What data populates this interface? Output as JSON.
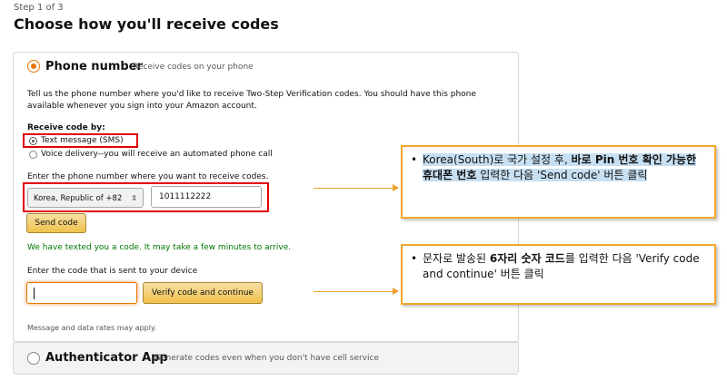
{
  "header": {
    "step": "Step 1 of 3",
    "title": "Choose how you'll receive codes"
  },
  "phone_option": {
    "title": "Phone number",
    "description": "Receive codes on your phone",
    "selected": true,
    "intro_line1": "Tell us the phone number where you'd like to receive Two-Step Verification codes. You should have this phone",
    "intro_line2": "available whenever you sign into your Amazon account.",
    "receive_label": "Receive code by:",
    "methods": [
      {
        "label": "Text message (SMS)",
        "selected": true
      },
      {
        "label": "Voice delivery--you will receive an automated phone call",
        "selected": false
      }
    ],
    "phone_label": "Enter the phone number where you want to receive codes.",
    "country_select": "Korea, Republic of +82",
    "phone_value": "1011112222",
    "send_button": "Send code",
    "sent_message": "We have texted you a code. It may take a few minutes to arrive.",
    "code_label": "Enter the code that is sent to your device",
    "code_value": "",
    "verify_button": "Verify code and continue",
    "footnote": "Message and data rates may apply."
  },
  "auth_option": {
    "title": "Authenticator App",
    "description": "Generate codes even when you don't have cell service",
    "selected": false
  },
  "callouts": {
    "first": {
      "part1": "Korea(South)로 국가 설정 후, ",
      "bold1": "바로 Pin 번호 확인 가능한 휴대폰 번호",
      "part2": " 입력한 다음 'Send code' 버튼 클릭"
    },
    "second": {
      "part1": "문자로 발송된 ",
      "bold1": "6자리 숫자 코드",
      "part2": "를 입력한 다음 'Verify code and continue' 버튼 클릭"
    }
  },
  "colors": {
    "accent_orange": "#e77600",
    "success_green": "#007600",
    "annotation_red": "#e00000",
    "callout_border": "#f2a72b",
    "highlight_blue": "#c7dff2"
  },
  "icons": {
    "select_chevron": "chevron-updown-icon"
  }
}
